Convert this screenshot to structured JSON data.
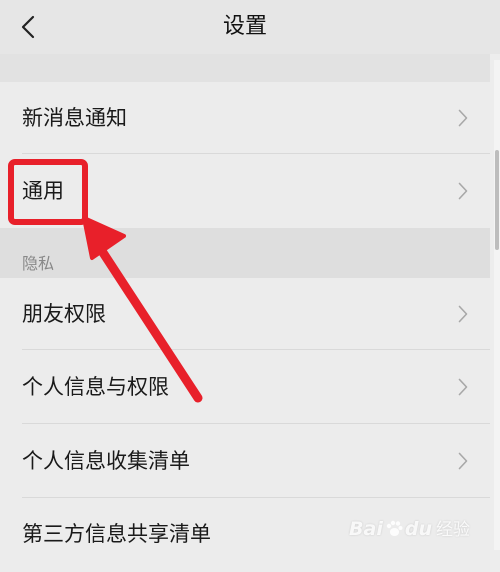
{
  "header": {
    "title": "设置",
    "back_icon": "chevron-left-icon"
  },
  "rows": [
    {
      "label": "新消息通知"
    },
    {
      "label": "通用"
    },
    {
      "label": "朋友权限"
    },
    {
      "label": "个人信息与权限"
    },
    {
      "label": "个人信息收集清单"
    },
    {
      "label": "第三方信息共享清单"
    }
  ],
  "section": {
    "privacy_label": "隐私"
  },
  "annotation": {
    "color": "#e8202a",
    "target": "通用"
  },
  "watermark": {
    "brand_left": "Bai",
    "brand_right": "du",
    "suffix": "经验"
  },
  "colors": {
    "background": "#ededed",
    "row": "#ececec",
    "header": "#e6e6e6",
    "highlight": "#e8202a"
  }
}
